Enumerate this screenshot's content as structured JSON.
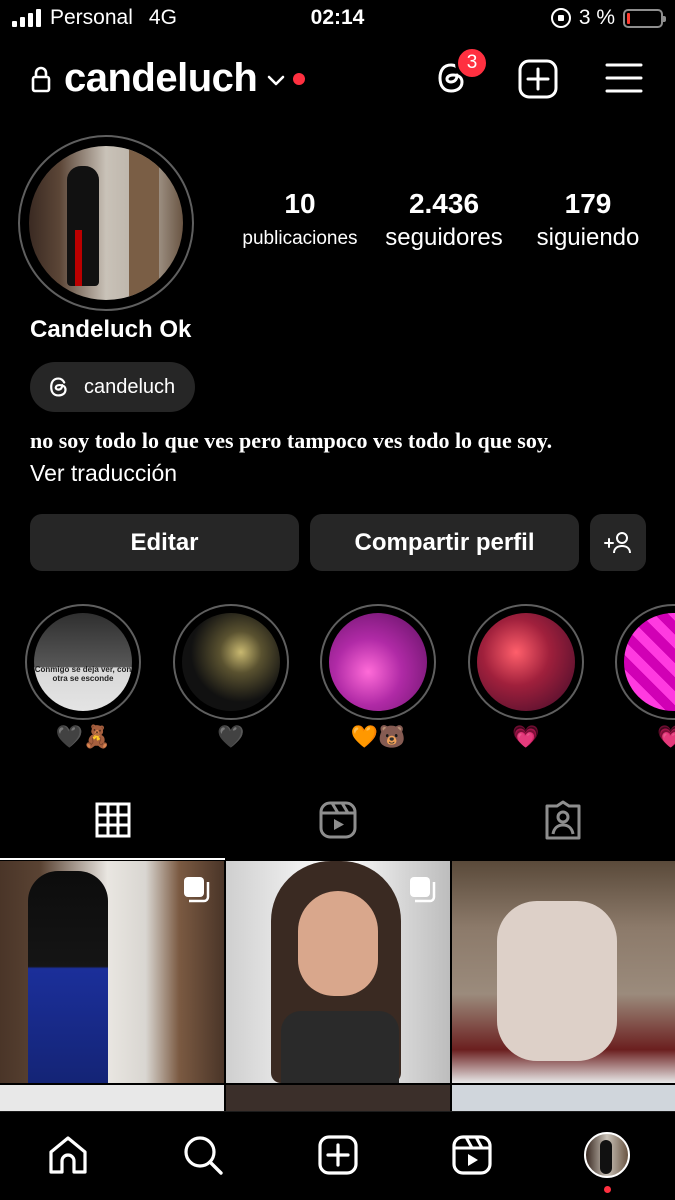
{
  "status_bar": {
    "carrier": "Personal",
    "network": "4G",
    "time": "02:14",
    "battery": "3 %",
    "battery_color": "#ff3b30"
  },
  "header": {
    "username": "candeluch",
    "threads_badge": "3",
    "accent": "#ff3040"
  },
  "profile": {
    "stats": [
      {
        "value": "10",
        "label": "publicaciones"
      },
      {
        "value": "2.436",
        "label": "seguidores"
      },
      {
        "value": "179",
        "label": "siguiendo"
      }
    ],
    "full_name": "Candeluch Ok",
    "threads_handle": "candeluch",
    "bio": "no soy todo lo que ves pero tampoco ves todo lo que soy.",
    "translate_label": "Ver traducción"
  },
  "actions": {
    "edit_label": "Editar",
    "share_label": "Compartir perfil"
  },
  "highlights": [
    {
      "caption": "🖤🧸"
    },
    {
      "caption": "🖤"
    },
    {
      "caption": "🧡🐻"
    },
    {
      "caption": "💗"
    },
    {
      "caption": "💗"
    }
  ],
  "highlight_text": "Conmigo se deja ver, con otra se esconde",
  "tabs": [
    {
      "icon": "grid-icon",
      "selected": true
    },
    {
      "icon": "reels-icon",
      "selected": false
    },
    {
      "icon": "tagged-icon",
      "selected": false
    }
  ],
  "bottom_nav": [
    {
      "icon": "home-icon"
    },
    {
      "icon": "search-icon"
    },
    {
      "icon": "create-icon"
    },
    {
      "icon": "reels-icon"
    },
    {
      "icon": "profile-avatar"
    }
  ]
}
